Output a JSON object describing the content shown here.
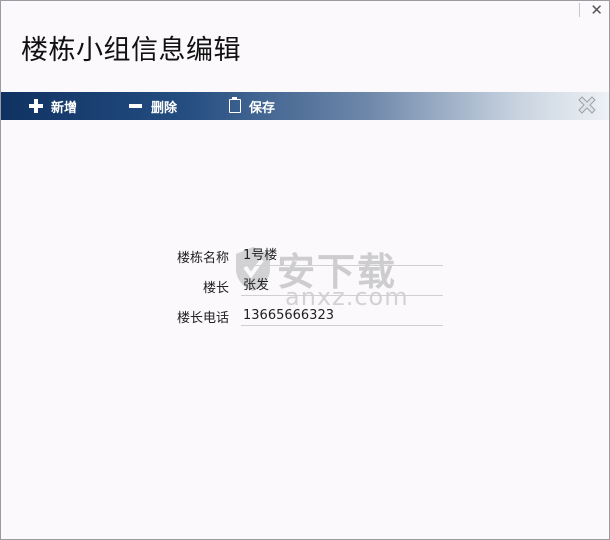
{
  "window": {
    "title": "楼栋小组信息编辑"
  },
  "toolbar": {
    "add_label": "新增",
    "delete_label": "删除",
    "save_label": "保存"
  },
  "form": {
    "fields": [
      {
        "label": "楼栋名称",
        "value": "1号楼"
      },
      {
        "label": "楼长",
        "value": "张发"
      },
      {
        "label": "楼长电话",
        "value": "13665666323"
      }
    ]
  },
  "watermark": {
    "text": "安下载",
    "sub": "anxz.com"
  },
  "colors": {
    "toolbar_start": "#0f3262",
    "toolbar_end": "#eef1f5",
    "background": "#fbf9fc"
  }
}
